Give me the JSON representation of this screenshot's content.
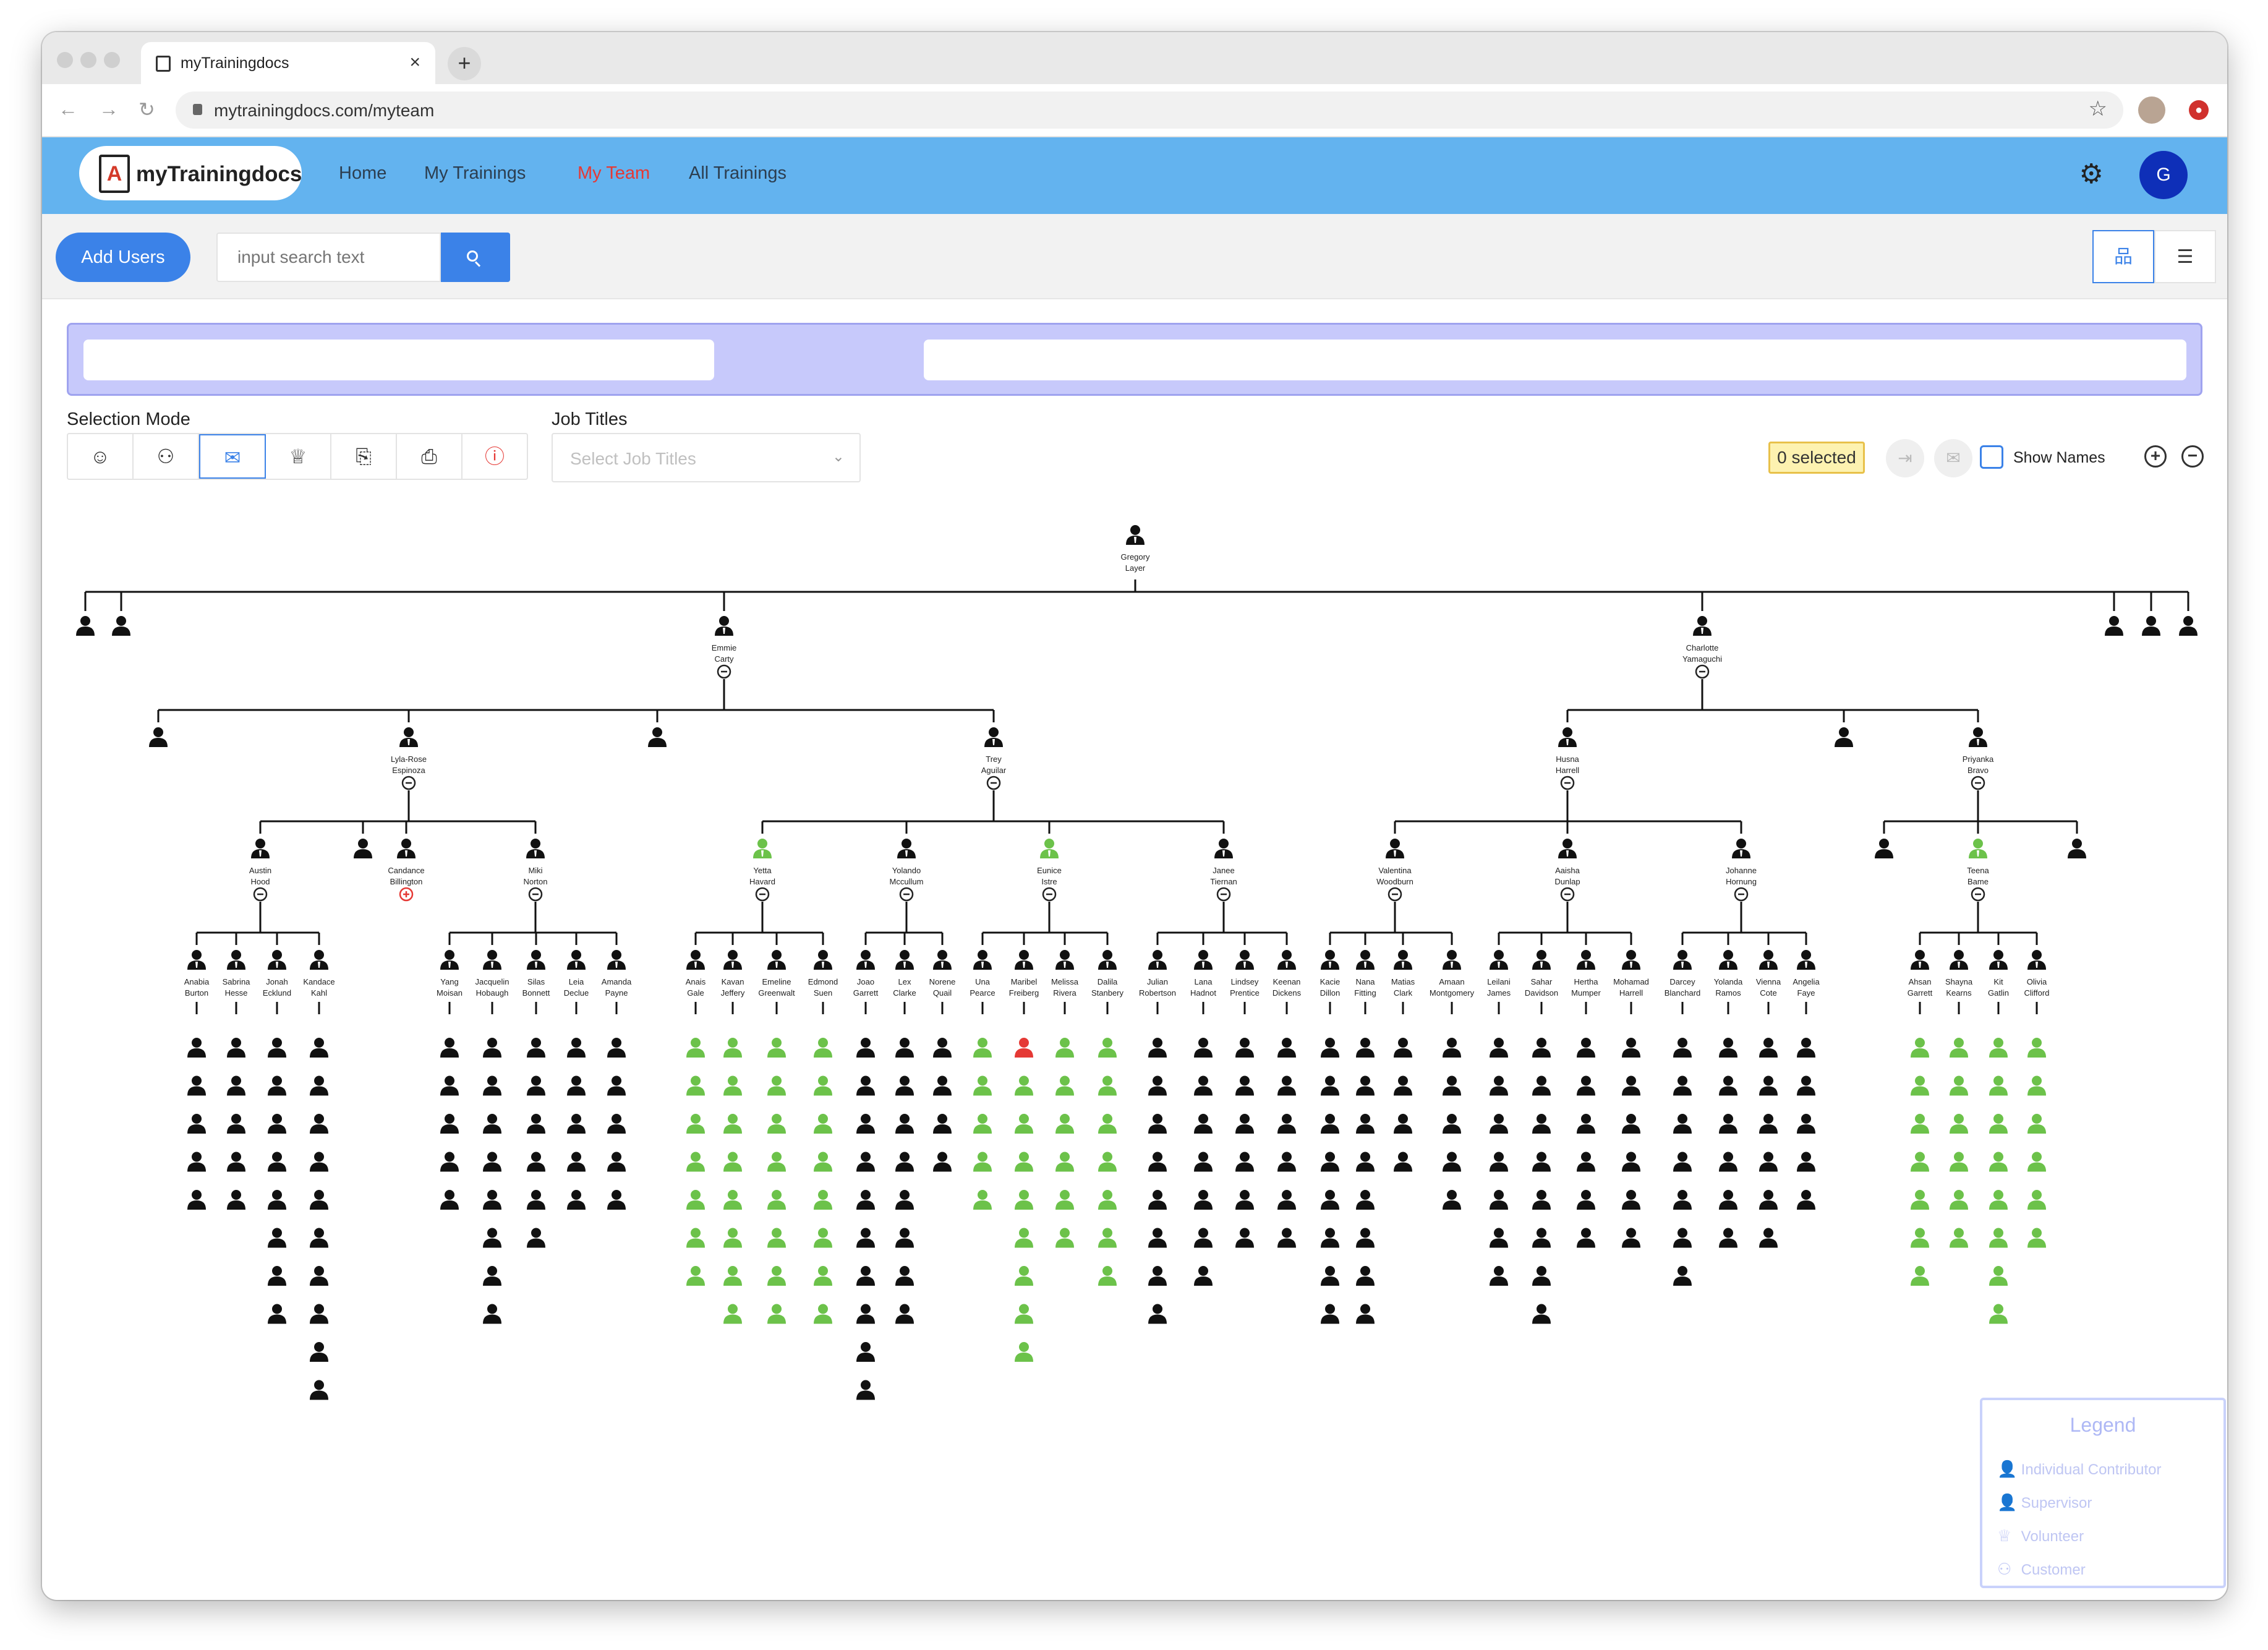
{
  "browser": {
    "tab_title": "myTrainingdocs",
    "new_tab": "+",
    "url": "mytrainingdocs.com/myteam"
  },
  "header": {
    "logo_mark": "A",
    "logo_text": "myTrainingdocs",
    "menu": [
      "Home",
      "My Trainings",
      "My Team",
      "All Trainings"
    ],
    "active_menu": "My Team",
    "avatar_initial": "G"
  },
  "actions": {
    "add_users": "Add Users",
    "search_placeholder": "input search text"
  },
  "filters": {
    "selection_mode_label": "Selection Mode",
    "job_titles_label": "Job Titles",
    "job_titles_placeholder": "Select Job Titles",
    "selected": "0 selected",
    "show_names": "Show Names",
    "modes": [
      {
        "icon": "user-icon",
        "glyph": "☺"
      },
      {
        "icon": "group-icon",
        "glyph": "⚇"
      },
      {
        "icon": "briefcase-icon",
        "glyph": "✉"
      },
      {
        "icon": "volunteer-icon",
        "glyph": "♕"
      },
      {
        "icon": "file-search-icon",
        "glyph": "⎘"
      },
      {
        "icon": "file-check-icon",
        "glyph": "⎙"
      },
      {
        "icon": "alert-icon",
        "glyph": "ⓘ"
      }
    ],
    "active_mode": 2
  },
  "colors": {
    "accent": "#3b82e8",
    "header": "#63b3ef",
    "active_menu": "#e53935",
    "completed": "#6cc24a",
    "overdue": "#e53935",
    "default": "#111111"
  },
  "legend": {
    "title": "Legend",
    "items": [
      {
        "icon": "contributor-icon",
        "label": "Individual Contributor"
      },
      {
        "icon": "supervisor-icon",
        "label": "Supervisor"
      },
      {
        "icon": "volunteer-icon",
        "label": "Volunteer"
      },
      {
        "icon": "customer-icon",
        "label": "Customer"
      }
    ]
  },
  "org_chart": {
    "root": "Gregory Layer",
    "level1": [
      null,
      null,
      "Emmie Carty",
      "Charlotte Yamaguchi",
      null,
      null,
      null
    ],
    "groups": [
      {
        "parent": "Emmie Carty",
        "children": [
          null,
          "Lyla-Rose Espinoza",
          null,
          "Trey Aguilar"
        ]
      },
      {
        "parent": "Charlotte Yamaguchi",
        "children": [
          "Husna Harrell",
          null,
          "Priyanka Bravo"
        ]
      },
      {
        "parent": "Lyla-Rose Espinoza",
        "children": [
          "Austin Hood",
          null,
          "Candance Billington",
          "Miki Norton"
        ]
      },
      {
        "parent": "Trey Aguilar",
        "children": [
          "Yetta Havard",
          "Yolando Mccullum",
          "Eunice Istre",
          "Janee Tiernan"
        ]
      },
      {
        "parent": "Husna Harrell",
        "children": [
          "Valentina Woodburn",
          "Aaisha Dunlap",
          "Johanne Hornung"
        ]
      },
      {
        "parent": "Priyanka Bravo",
        "children": [
          null,
          "Teena Bame",
          null
        ]
      }
    ],
    "collapsed": [
      "Candance Billington"
    ],
    "completed_nodes": [
      "Yetta Havard",
      "Eunice Istre",
      "Teena Bame"
    ],
    "teams": [
      {
        "manager": "Austin Hood",
        "members": [
          {
            "name": "Anabia Burton",
            "reports": 5
          },
          {
            "name": "Sabrina Hesse",
            "reports": 5
          },
          {
            "name": "Jonah Ecklund",
            "reports": 8
          },
          {
            "name": "Kandace Kahl",
            "reports": 10
          }
        ]
      },
      {
        "manager": "Miki Norton",
        "members": [
          {
            "name": "Yang Moisan",
            "reports": 5
          },
          {
            "name": "Jacquelin Hobaugh",
            "reports": 8
          },
          {
            "name": "Silas Bonnett",
            "reports": 6
          },
          {
            "name": "Leia Declue",
            "reports": 5
          },
          {
            "name": "Amanda Payne",
            "reports": 5
          }
        ]
      },
      {
        "manager": "Yetta Havard",
        "members": [
          {
            "name": "Anais Gale",
            "reports": 7,
            "completed": true
          },
          {
            "name": "Kavan Jeffery",
            "reports": 8,
            "completed": true
          },
          {
            "name": "Emeline Greenwalt",
            "reports": 8,
            "completed": true
          },
          {
            "name": "Edmond Suen",
            "reports": 8,
            "completed": true
          }
        ]
      },
      {
        "manager": "Yolando Mccullum",
        "members": [
          {
            "name": "Joao Garrett",
            "reports": 10
          },
          {
            "name": "Lex Clarke",
            "reports": 8
          },
          {
            "name": "Norene Quail",
            "reports": 4
          }
        ]
      },
      {
        "manager": "Eunice Istre",
        "members": [
          {
            "name": "Una Pearce",
            "reports": 5,
            "completed": true
          },
          {
            "name": "Maribel Freiberg",
            "reports": 9,
            "completed": true,
            "overdue_first": true
          },
          {
            "name": "Melissa Rivera",
            "reports": 6,
            "completed": true
          },
          {
            "name": "Dalila Stanbery",
            "reports": 7,
            "completed": true
          }
        ]
      },
      {
        "manager": "Janee Tiernan",
        "members": [
          {
            "name": "Julian Robertson",
            "reports": 8
          },
          {
            "name": "Lana Hadnot",
            "reports": 7
          },
          {
            "name": "Lindsey Prentice",
            "reports": 6
          },
          {
            "name": "Keenan Dickens",
            "reports": 6
          }
        ]
      },
      {
        "manager": "Valentina Woodburn",
        "members": [
          {
            "name": "Kacie Dillon",
            "reports": 8
          },
          {
            "name": "Nana Fitting",
            "reports": 8
          },
          {
            "name": "Matias Clark",
            "reports": 4
          },
          {
            "name": "Amaan Montgomery",
            "reports": 5
          }
        ]
      },
      {
        "manager": "Aaisha Dunlap",
        "members": [
          {
            "name": "Leilani James",
            "reports": 7
          },
          {
            "name": "Sahar Davidson",
            "reports": 8
          },
          {
            "name": "Hertha Mumper",
            "reports": 6
          },
          {
            "name": "Mohamad Harrell",
            "reports": 6
          }
        ]
      },
      {
        "manager": "Johanne Hornung",
        "members": [
          {
            "name": "Darcey Blanchard",
            "reports": 7
          },
          {
            "name": "Yolanda Ramos",
            "reports": 6
          },
          {
            "name": "Vienna Cote",
            "reports": 6
          },
          {
            "name": "Angelia Faye",
            "reports": 5
          }
        ]
      },
      {
        "manager": "Teena Bame",
        "members": [
          {
            "name": "Ahsan Garrett",
            "reports": 7,
            "completed": true
          },
          {
            "name": "Shayna Kearns",
            "reports": 6,
            "completed": true
          },
          {
            "name": "Kit Gatlin",
            "reports": 8,
            "completed": true
          },
          {
            "name": "Olivia Clifford",
            "reports": 6,
            "completed": true
          }
        ]
      }
    ]
  }
}
